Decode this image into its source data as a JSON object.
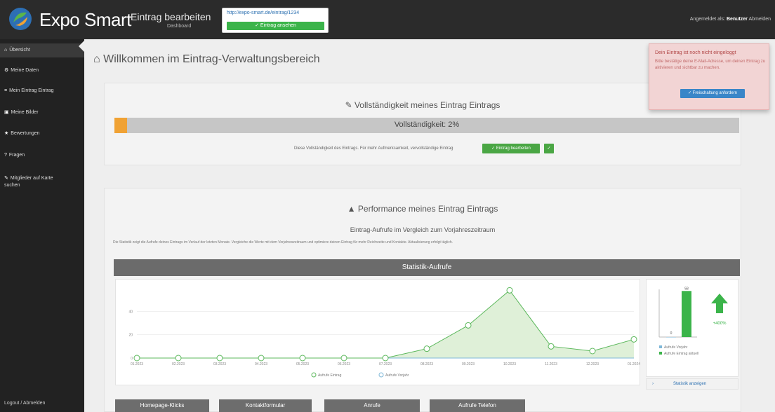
{
  "colors": {
    "brand_green": "#3bb44a",
    "progress_orange": "#f0a234",
    "alert_blue": "#3a86c8",
    "chart_line": "#5cb85c",
    "chart_fill": "#dff0d8",
    "arrow_green": "#3bb44a"
  },
  "header": {
    "brand": "Expo Smart",
    "page_name": "Eintrag bearbeiten",
    "page_sub": "Dashboard",
    "url": "http://expo-smart.de/eintrag/1234",
    "url_button": "✓ Eintrag ansehen",
    "user_text": "Angemeldet als:",
    "user_name": "Benutzer",
    "logout": "Abmelden"
  },
  "sidebar": {
    "items": [
      {
        "icon": "home-icon",
        "glyph": "⌂",
        "label": "Übersicht"
      },
      {
        "icon": "gear-icon",
        "glyph": "⚙",
        "label": "Meine Daten"
      },
      {
        "icon": "list-icon",
        "glyph": "≡",
        "label": "Mein Eintrag Eintrag"
      },
      {
        "icon": "images-icon",
        "glyph": "▣",
        "label": "Meine Bilder"
      },
      {
        "icon": "star-icon",
        "glyph": "★",
        "label": "Bewertungen"
      },
      {
        "icon": "question-icon",
        "glyph": "?",
        "label": "Fragen"
      },
      {
        "icon": "pin-icon",
        "glyph": "✎",
        "label": "Mitglieder auf Karte suchen"
      }
    ],
    "footer": "Logout / Abmelden"
  },
  "main": {
    "title": "Willkommen im Eintrag-Verwaltungsbereich"
  },
  "completeness": {
    "title": "Vollständigkeit meines Eintrag Eintrags",
    "progress_label": "Vollständigkeit: 2%",
    "progress_fraction": 0.02,
    "note": "Diese Vollständigkeit des Eintrags. Für mehr Aufmerksamkeit, vervollständige Eintrag",
    "button": "✓ Eintrag bearbeiten",
    "button_small": "✓"
  },
  "alert": {
    "heading": "Dein Eintrag ist noch nicht eingeloggt",
    "body": "Bitte bestätige deine E-Mail-Adresse, um deinen Eintrag zu aktivieren und sichtbar zu machen.",
    "button": "✓ Freischaltung anfordern"
  },
  "performance": {
    "title": "Performance meines Eintrag Eintrags",
    "subtitle": "Eintrag-Aufrufe im Vergleich zum Vorjahreszeitraum",
    "description": "Die Statistik zeigt die Aufrufe deines Eintrags im Verlauf der letzten Monate. Vergleiche die Werte mit dem Vorjahreszeitraum und optimiere deinen Eintrag für mehr Reichweite und Kontakte. Aktualisierung erfolgt täglich.",
    "chart_header": "Statistik-Aufrufe",
    "legend_left": "Aufrufe Eintrag",
    "legend_right": "Aufrufe Vorjahr",
    "cmp_legend_1": "Aufrufe Vorjahr",
    "cmp_legend_2": "Aufrufe Eintrag aktuell",
    "cmp_footer": "Statistik anzeigen",
    "growth": "+400%"
  },
  "bottom_buttons": [
    "Homepage-Klicks",
    "Kontaktformular",
    "Anrufe",
    "Aufrufe Telefon"
  ],
  "chart_data": {
    "type": "line",
    "x": [
      "01.2023",
      "02.2023",
      "03.2023",
      "04.2023",
      "05.2023",
      "06.2023",
      "07.2023",
      "08.2023",
      "09.2023",
      "10.2023",
      "11.2023",
      "12.2023",
      "01.2024"
    ],
    "series": [
      {
        "name": "Aufrufe Eintrag",
        "values": [
          0,
          0,
          0,
          0,
          0,
          0,
          0,
          8,
          28,
          58,
          10,
          6,
          16
        ]
      },
      {
        "name": "Aufrufe Vorjahr",
        "values": [
          0,
          0,
          0,
          0,
          0,
          0,
          0,
          0,
          0,
          0,
          0,
          0,
          0
        ]
      }
    ],
    "ylim": [
      0,
      60
    ],
    "compare": {
      "type": "bar",
      "categories": [
        "Aufrufe Vorjahr",
        "Aufrufe Eintrag aktuell"
      ],
      "values": [
        0,
        58
      ],
      "labels": [
        "0",
        "58"
      ]
    }
  }
}
